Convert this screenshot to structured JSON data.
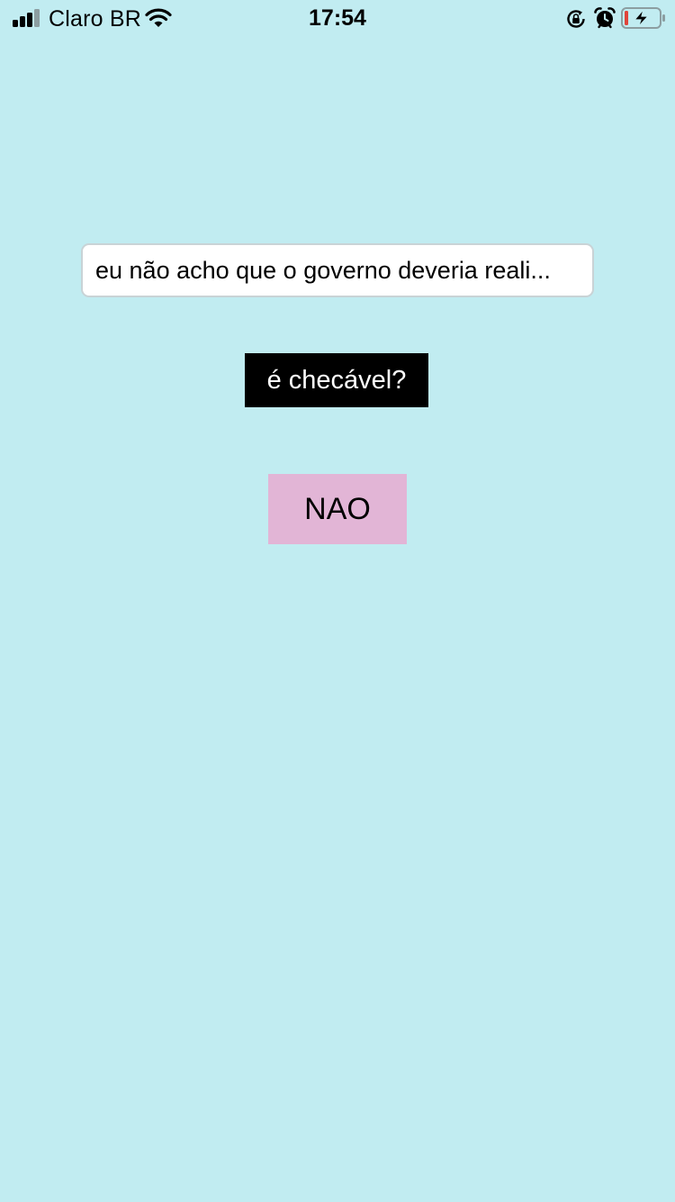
{
  "status_bar": {
    "carrier": "Claro BR",
    "time": "17:54",
    "signal_bars_filled": 3,
    "signal_bars_total": 4,
    "icons": [
      "cellular-signal-icon",
      "wifi-icon",
      "rotation-lock-icon",
      "alarm-icon",
      "battery-charging-icon"
    ],
    "battery_level": 0.1,
    "battery_low_color": "#e0443a"
  },
  "main": {
    "statement_input": {
      "value": "eu não acho que o governo deveria reali..."
    },
    "check_button_label": "é checável?",
    "result_label": "NAO"
  },
  "colors": {
    "background": "#c1ecf1",
    "check_button_bg": "#000000",
    "result_bg": "#e2b5d6"
  }
}
